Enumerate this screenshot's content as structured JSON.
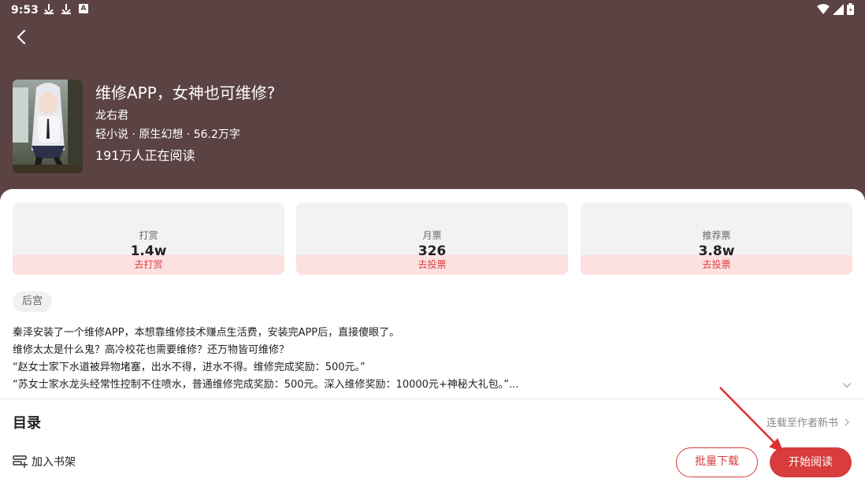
{
  "status_bar": {
    "time": "9:53",
    "left_icons": [
      "download-icon",
      "download-icon",
      "a-icon"
    ],
    "right_icons": [
      "wifi-icon",
      "signal-icon",
      "battery-icon"
    ],
    "a_letter": "A"
  },
  "book": {
    "title": "维修APP，女神也可维修?",
    "author": "龙右君",
    "meta": "轻小说 · 原生幻想 · 56.2万字",
    "readers": "191万人正在阅读"
  },
  "stats": [
    {
      "label": "打赏",
      "value": "1.4w",
      "action": "去打赏"
    },
    {
      "label": "月票",
      "value": "326",
      "action": "去投票"
    },
    {
      "label": "推荐票",
      "value": "3.8w",
      "action": "去投票"
    }
  ],
  "tag": "后宫",
  "synopsis": [
    "秦泽安装了一个维修APP，本想靠维修技术赚点生活费，安装完APP后，直接傻眼了。",
    "维修太太是什么鬼？高冷校花也需要维修？还万物皆可维修？",
    "“赵女士家下水道被异物堵塞，出水不得，进水不得。维修完成奖励：500元。”",
    "“苏女士家水龙头经常性控制不住喷水，普通维修完成奖励：500元。深入维修奖励：10000元+神秘大礼包。”..."
  ],
  "toc": {
    "title": "目录",
    "status": "连载至作者新书"
  },
  "bottom": {
    "shelf_label": "加入书架",
    "batch_download": "批量下载",
    "start_reading": "开始阅读"
  },
  "colors": {
    "header_bg": "#5c4343",
    "accent": "#d83c3c",
    "action_bg": "#fde0e0",
    "arrow": "#e03030"
  }
}
